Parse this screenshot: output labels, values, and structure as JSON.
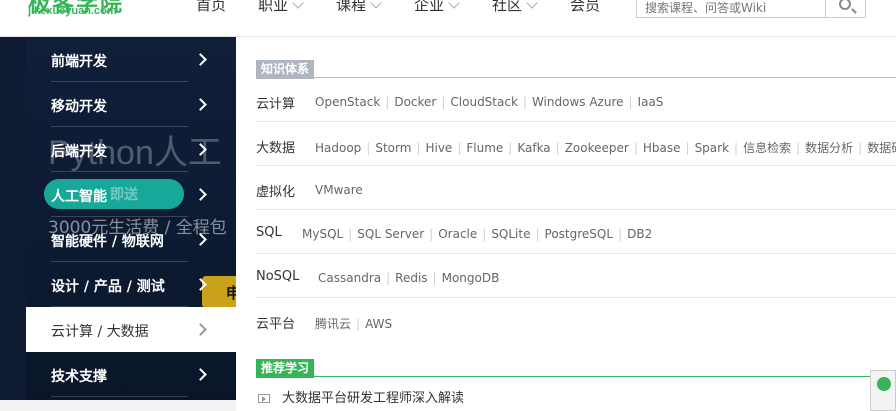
{
  "header": {
    "logo_cn": "极客学院",
    "logo_en": "jikexueyuan.com",
    "nav": [
      {
        "label": "首页",
        "has_dropdown": false
      },
      {
        "label": "职业",
        "has_dropdown": true
      },
      {
        "label": "课程",
        "has_dropdown": true
      },
      {
        "label": "企业",
        "has_dropdown": true
      },
      {
        "label": "社区",
        "has_dropdown": true
      },
      {
        "label": "会员",
        "has_dropdown": false
      }
    ],
    "search_placeholder": "搜索课程、问答或Wiki",
    "search_icon": "search-icon"
  },
  "banner": {
    "text1": "Python人工",
    "badge": "即送",
    "text2": "3000元生活费 / 全程包",
    "yellow": "申"
  },
  "menu": [
    {
      "label": "前端开发",
      "active": false
    },
    {
      "label": "移动开发",
      "active": false
    },
    {
      "label": "后端开发",
      "active": false
    },
    {
      "label": "人工智能",
      "active": false
    },
    {
      "label": "智能硬件 / 物联网",
      "active": false
    },
    {
      "label": "设计 / 产品 / 测试",
      "active": false
    },
    {
      "label": "云计算 / 大数据",
      "active": true
    },
    {
      "label": "技术支撑",
      "active": false
    }
  ],
  "knowledge": {
    "title": "知识体系",
    "rows": [
      {
        "category": "云计算",
        "links": [
          "OpenStack",
          "Docker",
          "CloudStack",
          "Windows Azure",
          "IaaS"
        ]
      },
      {
        "category": "大数据",
        "links": [
          "Hadoop",
          "Storm",
          "Hive",
          "Flume",
          "Kafka",
          "Zookeeper",
          "Hbase",
          "Spark",
          "信息检索",
          "数据分析",
          "数据研发"
        ]
      },
      {
        "category": "虚拟化",
        "links": [
          "VMware"
        ]
      },
      {
        "category": "SQL",
        "links": [
          "MySQL",
          "SQL Server",
          "Oracle",
          "SQLite",
          "PostgreSQL",
          "DB2"
        ]
      },
      {
        "category": "NoSQL",
        "links": [
          "Cassandra",
          "Redis",
          "MongoDB"
        ]
      },
      {
        "category": "云平台",
        "links": [
          "腾讯云",
          "AWS"
        ]
      }
    ]
  },
  "recommend": {
    "title": "推荐学习",
    "items": [
      "大数据平台研发工程师深入解读"
    ]
  }
}
